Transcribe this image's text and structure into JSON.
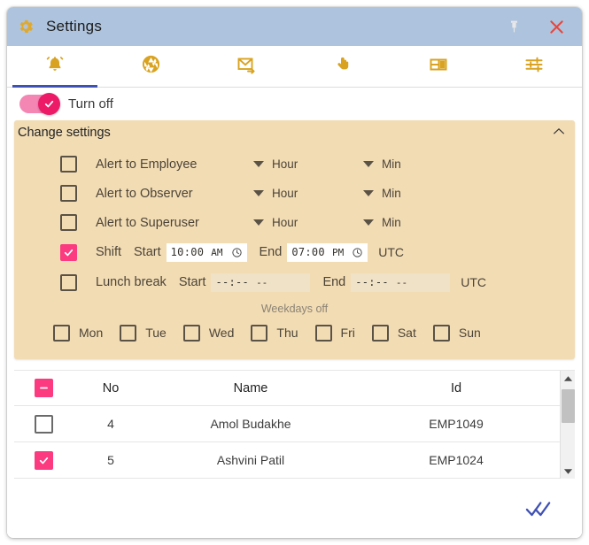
{
  "window": {
    "title": "Settings",
    "gear_icon": "gear-icon",
    "pin_icon": "pin-icon",
    "close_icon": "close-icon",
    "titlebar_color": "#aec3dd"
  },
  "tabs": [
    {
      "name": "notifications",
      "icon": "bell-icon",
      "active": true
    },
    {
      "name": "camera",
      "icon": "aperture-icon",
      "active": false
    },
    {
      "name": "mail",
      "icon": "mail-forward-icon",
      "active": false
    },
    {
      "name": "touch",
      "icon": "pointing-hand-icon",
      "active": false
    },
    {
      "name": "layout",
      "icon": "panel-layout-icon",
      "active": false
    },
    {
      "name": "tuning",
      "icon": "sliders-icon",
      "active": false
    }
  ],
  "tab_accent_color": "#3f51b5",
  "tab_icon_color": "#d9a321",
  "toggle": {
    "label": "Turn off",
    "state": "on",
    "track_color": "#f486b4",
    "knob_color": "#ec1a67"
  },
  "panel": {
    "title": "Change settings",
    "background_color": "#f2dcb4",
    "collapse_icon": "chevron-up-icon",
    "expanded": true,
    "alert_rows": [
      {
        "label": "Alert to Employee",
        "checked": false,
        "hour": "Hour",
        "min": "Min"
      },
      {
        "label": "Alert to Observer",
        "checked": false,
        "hour": "Hour",
        "min": "Min"
      },
      {
        "label": "Alert to Superuser",
        "checked": false,
        "hour": "Hour",
        "min": "Min"
      }
    ],
    "shift": {
      "label": "Shift",
      "checked": true,
      "start_label": "Start",
      "start_time": "10:00",
      "start_meridiem": "AM",
      "end_label": "End",
      "end_time": "07:00",
      "end_meridiem": "PM",
      "timezone": "UTC",
      "clock_icon": "clock-icon",
      "enabled": true
    },
    "lunch": {
      "label": "Lunch break",
      "checked": false,
      "start_label": "Start",
      "start_time": "--:--",
      "start_meridiem": "--",
      "end_label": "End",
      "end_time": "--:--",
      "end_meridiem": "--",
      "timezone": "UTC",
      "enabled": false
    },
    "weekdays_title": "Weekdays off",
    "weekdays": [
      {
        "label": "Mon",
        "checked": false
      },
      {
        "label": "Tue",
        "checked": false
      },
      {
        "label": "Wed",
        "checked": false
      },
      {
        "label": "Thu",
        "checked": false
      },
      {
        "label": "Fri",
        "checked": false
      },
      {
        "label": "Sat",
        "checked": false
      },
      {
        "label": "Sun",
        "checked": false
      }
    ]
  },
  "table": {
    "select_all_state": "indeterminate",
    "columns": {
      "no": "No",
      "name": "Name",
      "id": "Id"
    },
    "rows": [
      {
        "checked": false,
        "no": "4",
        "name": "Amol Budakhe",
        "id": "EMP1049"
      },
      {
        "checked": true,
        "no": "5",
        "name": "Ashvini Patil",
        "id": "EMP1024"
      }
    ],
    "scrollbar": {
      "up_icon": "caret-up-icon",
      "down_icon": "caret-down-icon"
    }
  },
  "footer": {
    "confirm_icon": "double-check-icon",
    "confirm_color": "#3f51b5"
  },
  "checkbox_accent_color": "#fb3a7f"
}
